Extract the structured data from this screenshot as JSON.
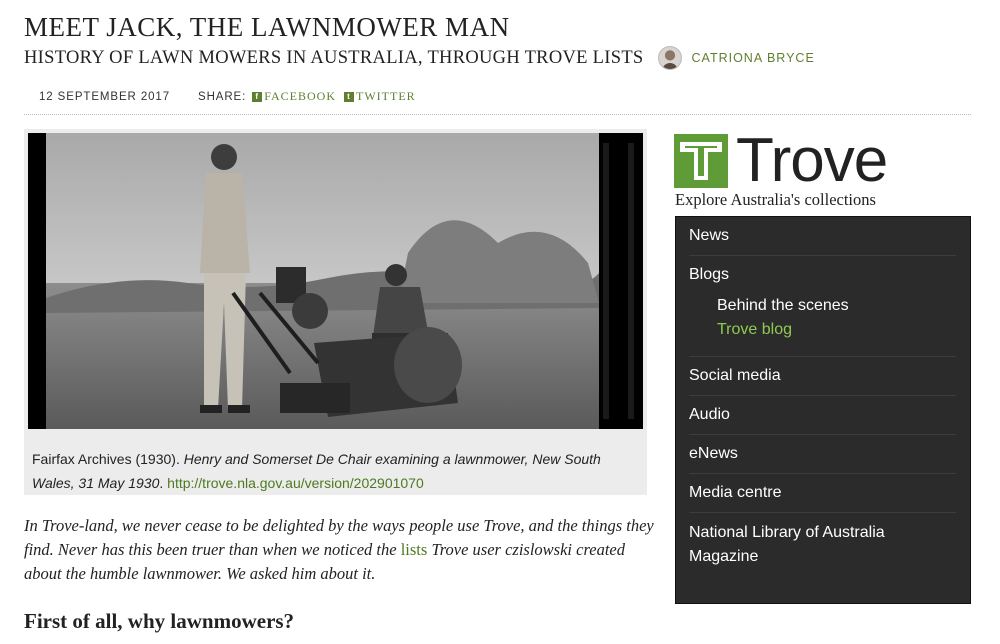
{
  "article": {
    "title": "MEET JACK, THE LAWNMOWER MAN",
    "subtitle": "HISTORY OF LAWN MOWERS IN AUSTRALIA, THROUGH TROVE LISTS",
    "author": "CATRIONA BRYCE",
    "date": "12 SEPTEMBER 2017",
    "share_label": "SHARE:",
    "share_facebook": "FACEBOOK",
    "share_twitter": "TWITTER"
  },
  "figure": {
    "caption_source": "Fairfax Archives (1930). ",
    "caption_italic": "Henry and Somerset De Chair examining a lawnmower, New South Wales, 31 May 1930",
    "caption_sep": ". ",
    "caption_link": "http://trove.nla.gov.au/version/202901070"
  },
  "body": {
    "intro_a": "In Trove-land, we never cease to be delighted by the ways people use Trove, and the things they find. Never has this been truer than when we noticed the ",
    "intro_link": "lists",
    "intro_b": " Trove user czislowski created about the humble lawnmower. We asked him about it.",
    "heading": "First of all, why lawnmowers?"
  },
  "sidebar": {
    "logo_text": "Trove",
    "tagline": "Explore Australia's collections",
    "nav": {
      "news": "News",
      "blogs": "Blogs",
      "behind_scenes": "Behind the scenes",
      "trove_blog": "Trove blog",
      "social_media": "Social media",
      "audio": "Audio",
      "enews": "eNews",
      "media_centre": "Media centre",
      "nla_magazine": "National Library of Australia Magazine"
    }
  },
  "colors": {
    "accent_green": "#5f7f2f",
    "trove_green": "#5f9b36",
    "nav_bg": "#2b2b2b",
    "nav_active": "#8fca4f"
  }
}
